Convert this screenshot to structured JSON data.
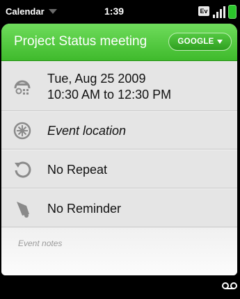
{
  "status_bar": {
    "app_name": "Calendar",
    "time": "1:39",
    "network": "Ev"
  },
  "header": {
    "title": "Project Status meeting",
    "calendar_button": "GOOGLE"
  },
  "event": {
    "date": "Tue, Aug 25 2009",
    "time_range": "10:30 AM to 12:30 PM",
    "location_placeholder": "Event location",
    "repeat": "No Repeat",
    "reminder": "No Reminder",
    "notes_placeholder": "Event notes"
  },
  "icons": {
    "status": [
      "chevron-down-icon",
      "signal-icon",
      "battery-icon"
    ],
    "rows": [
      "clock-icon",
      "location-icon",
      "repeat-icon",
      "reminder-icon"
    ],
    "footer": [
      "voicemail-icon"
    ]
  },
  "colors": {
    "header_green": "#4cc538",
    "battery_green": "#2bc62b",
    "row_background": "#e5e5e5"
  }
}
